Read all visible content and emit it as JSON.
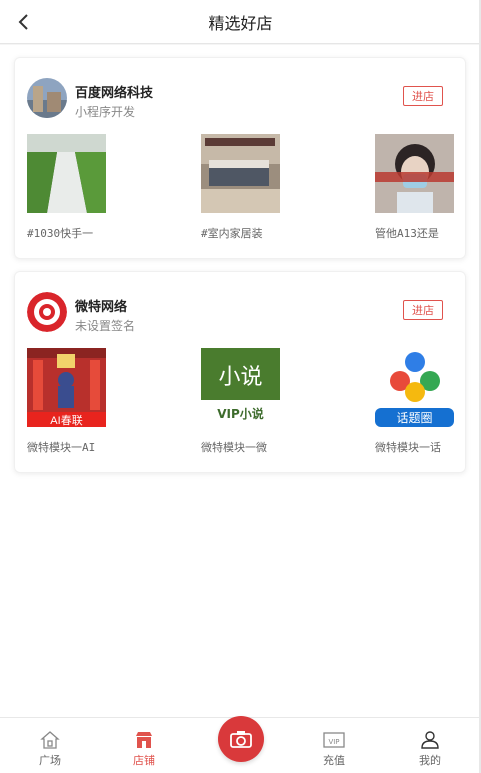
{
  "header": {
    "title": "精选好店"
  },
  "shops": [
    {
      "name": "百度网络科技",
      "subtitle": "小程序开发",
      "enter_label": "进店",
      "products": [
        {
          "name": "#1030快手一",
          "image": "greenhouse-photo"
        },
        {
          "name": "#室内家居装",
          "image": "bedroom-photo"
        },
        {
          "name": "管他A13还是",
          "image": "person-mask-photo"
        }
      ]
    },
    {
      "name": "微特网络",
      "subtitle": "未设置签名",
      "enter_label": "进店",
      "products": [
        {
          "name": "微特模块一AI",
          "image": "ai-spring-couplet",
          "badge": "AI春联"
        },
        {
          "name": "微特模块一微",
          "image": "novel-tile",
          "title": "小说",
          "badge": "VIP小说"
        },
        {
          "name": "微特模块一话",
          "image": "topic-circle",
          "badge": "话题圈"
        }
      ]
    }
  ],
  "tabbar": {
    "items": [
      {
        "label": "广场",
        "icon": "home-icon"
      },
      {
        "label": "店铺",
        "icon": "shop-icon",
        "active": true
      },
      {
        "label": "",
        "icon": "camera-icon"
      },
      {
        "label": "充值",
        "icon": "vip-icon"
      },
      {
        "label": "我的",
        "icon": "user-icon"
      }
    ]
  },
  "colors": {
    "accent": "#e0534d",
    "camera": "#d9393b"
  }
}
